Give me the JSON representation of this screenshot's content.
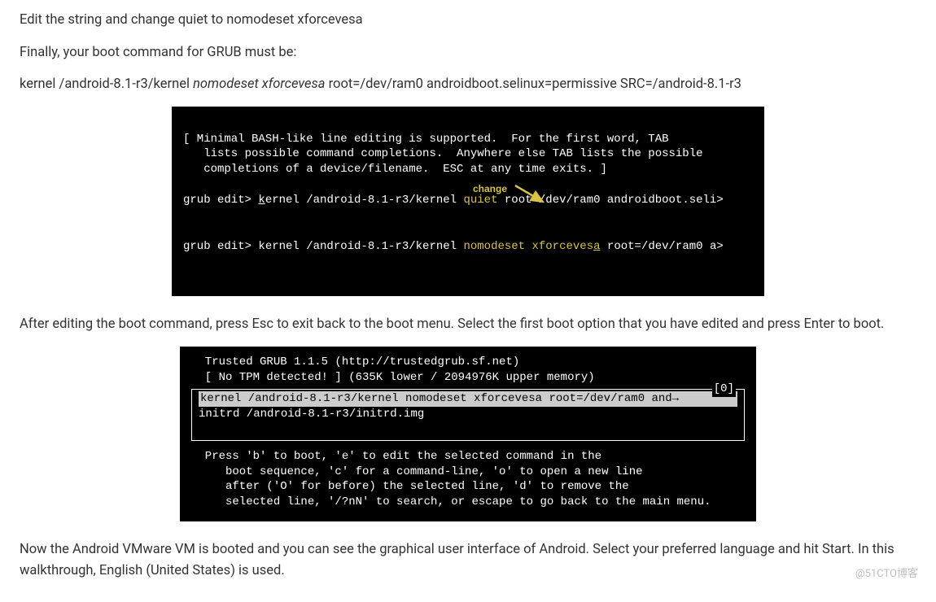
{
  "p1": "Edit the string and change quiet to nomodeset xforcevesa",
  "p2": "Finally, your boot command for GRUB must be:",
  "cmd_before": "kernel /android-8.1-r3/kernel ",
  "cmd_italic": "nomodeset xforcevesa",
  "cmd_after": " root=/dev/ram0 androidboot.selinux=permissive SRC=/android-8.1-r3",
  "term1_banner": "[ Minimal BASH-like line editing is supported.  For the first word, TAB\n   lists possible command completions.  Anywhere else TAB lists the possible\n   completions of a device/filename.  ESC at any time exits. ]",
  "term1_line1_pre": "grub edit> ",
  "term1_line1_u": "k",
  "term1_line1_mid": "ernel /android-8.1-r3/kernel ",
  "term1_line1_hl": "quiet",
  "term1_line1_post": " root=/dev/ram0 androidboot.seli>",
  "term1_change": "change",
  "term1_line2_pre": "grub edit> kernel /android-8.1-r3/kernel ",
  "term1_line2_hl": "nomodeset xforceves",
  "term1_line2_hl_u": "a",
  "term1_line2_post": " root=/dev/ram0 a>",
  "p3": "After editing the boot command, press Esc to exit back to the boot menu. Select the first boot option that you have edited and press Enter to boot.",
  "grub_header": "  Trusted GRUB 1.1.5 (http://trustedgrub.sf.net)\n  [ No TPM detected! ] (635K lower / 2094976K upper memory)",
  "grub_corner": "[0]",
  "grub_sel": "kernel /android-8.1-r3/kernel nomodeset xforcevesa root=/dev/ram0 and→",
  "grub_line2": "initrd /android-8.1-r3/initrd.img",
  "grub_instr": "  Press 'b' to boot, 'e' to edit the selected command in the\n     boot sequence, 'c' for a command-line, 'o' to open a new line\n     after ('O' for before) the selected line, 'd' to remove the\n     selected line, '/?nN' to search, or escape to go back to the main menu.",
  "p4": "Now the Android VMware VM is booted and you can see the graphical user interface of Android. Select your preferred language and hit Start. In this walkthrough, English (United States) is used.",
  "watermark": "@51CTO博客"
}
